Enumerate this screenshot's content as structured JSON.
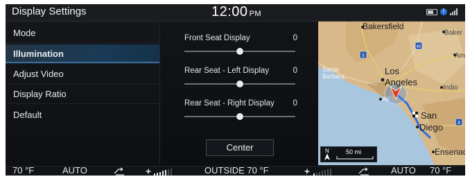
{
  "header": {
    "title": "Display Settings",
    "time": "12:00",
    "ampm": "PM"
  },
  "menu": {
    "items": [
      {
        "label": "Mode",
        "active": false
      },
      {
        "label": "Illumination",
        "active": true
      },
      {
        "label": "Adjust Video",
        "active": false
      },
      {
        "label": "Display Ratio",
        "active": false
      },
      {
        "label": "Default",
        "active": false
      }
    ]
  },
  "sliders": [
    {
      "label": "Front Seat Display",
      "value": "0"
    },
    {
      "label": "Rear Seat - Left Display",
      "value": "0"
    },
    {
      "label": "Rear Seat - Right Display",
      "value": "0"
    }
  ],
  "center_button": "Center",
  "map": {
    "labels": [
      "Bakersfield",
      "Baker",
      "Amb",
      "Santa",
      "Barbara",
      "Los",
      "Angeles",
      "Indio",
      "Av",
      "San",
      "Diego",
      "Ensenad"
    ],
    "highway_shields": [
      "5",
      "40",
      "8"
    ],
    "scale": {
      "north": "N",
      "distance": "50 mi"
    },
    "colors": {
      "land": "#d8b98a",
      "ocean": "#a9c6df",
      "route": "#2f6ee0",
      "vehicle": "#e23a1f"
    }
  },
  "climate": {
    "left_temp": "70 °F",
    "left_mode": "AUTO",
    "outside": "OUTSIDE  70 °F",
    "right_mode": "AUTO",
    "right_temp": "70 °F",
    "left_fan_level": 5,
    "right_fan_level": 1,
    "fan_max": 7
  }
}
